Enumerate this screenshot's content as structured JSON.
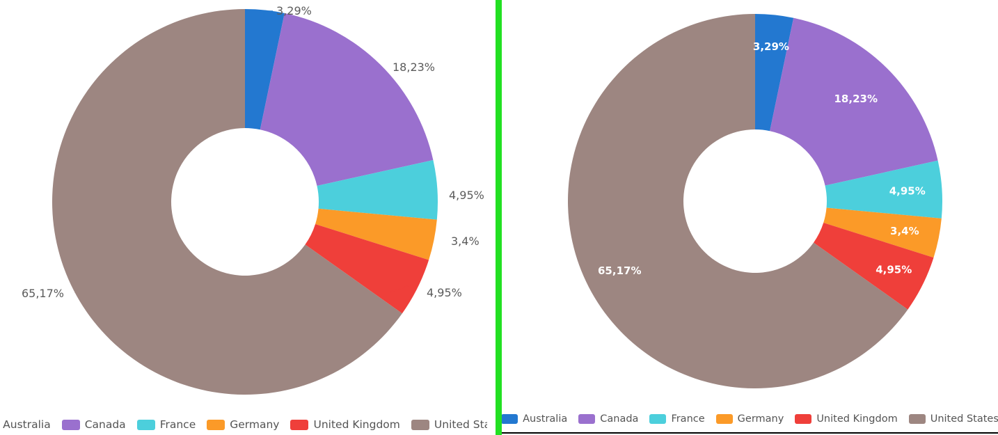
{
  "chart_data": [
    {
      "id": "left-donut",
      "type": "pie",
      "title": "",
      "variant": "donut-outside-labels",
      "label_style": "outside-with-leader-lines",
      "legend_position": "bottom",
      "categories": [
        "Australia",
        "Canada",
        "France",
        "Germany",
        "United Kingdom",
        "United States"
      ],
      "values": [
        3.29,
        18.23,
        4.95,
        3.4,
        4.95,
        65.17
      ],
      "labels": [
        "3,29%",
        "18,23%",
        "4,95%",
        "3,4%",
        "4,95%",
        "65,17%"
      ],
      "colors": [
        "#2378d0",
        "#9a70ce",
        "#4ccfdc",
        "#fb9a28",
        "#ef3f3a",
        "#9d8681"
      ]
    },
    {
      "id": "right-donut",
      "type": "pie",
      "title": "",
      "variant": "donut-inside-labels",
      "label_style": "inside-white-bold",
      "legend_position": "bottom",
      "categories": [
        "Australia",
        "Canada",
        "France",
        "Germany",
        "United Kingdom",
        "United States"
      ],
      "values": [
        3.29,
        18.23,
        4.95,
        3.4,
        4.95,
        65.17
      ],
      "labels": [
        "3,29%",
        "18,23%",
        "4,95%",
        "3,4%",
        "4,95%",
        "65,17%"
      ],
      "colors": [
        "#2378d0",
        "#9a70ce",
        "#4ccfdc",
        "#fb9a28",
        "#ef3f3a",
        "#9d8681"
      ]
    }
  ],
  "left_panel": {
    "legend": {
      "items": [
        {
          "label": "Australia",
          "color": "#2378d0"
        },
        {
          "label": "Canada",
          "color": "#9a70ce"
        },
        {
          "label": "France",
          "color": "#4ccfdc"
        },
        {
          "label": "Germany",
          "color": "#fb9a28"
        },
        {
          "label": "United Kingdom",
          "color": "#ef3f3a"
        },
        {
          "label": "United States",
          "color": "#9d8681"
        }
      ]
    },
    "slice_labels": [
      "3,29%",
      "18,23%",
      "4,95%",
      "3,4%",
      "4,95%",
      "65,17%"
    ]
  },
  "right_panel": {
    "legend": {
      "items": [
        {
          "label": "Australia",
          "color": "#2378d0"
        },
        {
          "label": "Canada",
          "color": "#9a70ce"
        },
        {
          "label": "France",
          "color": "#4ccfdc"
        },
        {
          "label": "Germany",
          "color": "#fb9a28"
        },
        {
          "label": "United Kingdom",
          "color": "#ef3f3a"
        },
        {
          "label": "United States",
          "color": "#9d8681"
        }
      ]
    },
    "slice_labels": [
      "3,29%",
      "18,23%",
      "4,95%",
      "3,4%",
      "4,95%",
      "65,17%"
    ]
  },
  "divider": {
    "color": "#22e022"
  },
  "theme": {
    "background": "#ffffff",
    "label_text_color": "#5b5b5b",
    "legend_text_color": "#545454",
    "inside_label_color": "#ffffff"
  }
}
